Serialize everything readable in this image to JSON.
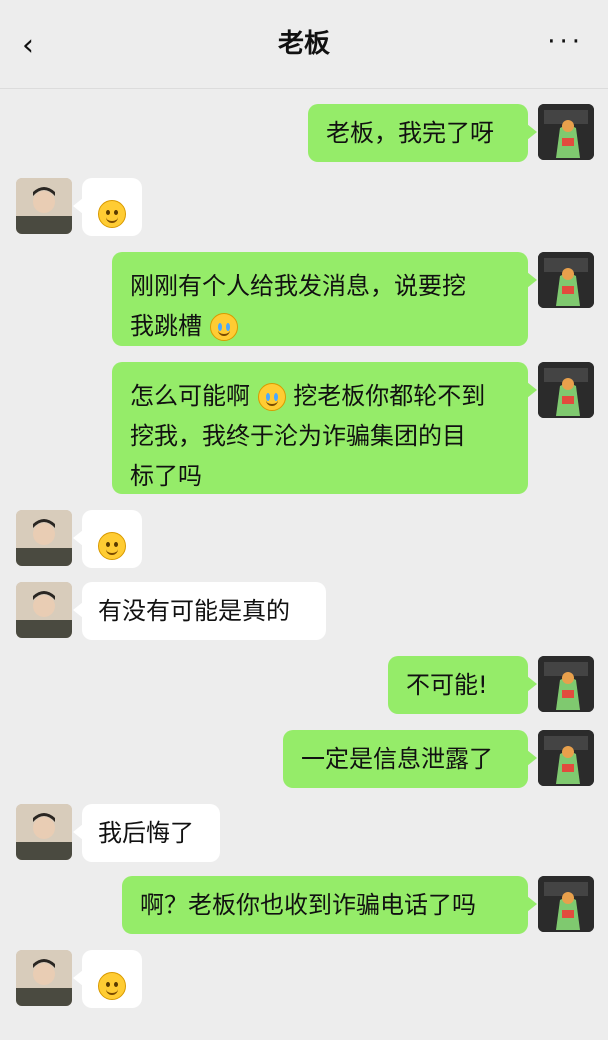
{
  "nav": {
    "back_glyph": "‹",
    "title": "老板",
    "more_glyph": "···"
  },
  "messages": [
    {
      "sender": "me",
      "text": "老板，我完了呀"
    },
    {
      "sender": "other",
      "text": "",
      "emoji": "thinking-face-icon"
    },
    {
      "sender": "me",
      "text_parts": [
        "刚刚有个人给我发消息，说要挖",
        "我跳槽"
      ],
      "emoji": "crying-face-icon"
    },
    {
      "sender": "me",
      "text_parts": [
        "怎么可能啊",
        "挖老板你都轮不到",
        "挖我，我终于沦为诈骗集团的目",
        "标了吗"
      ],
      "emoji": "crying-face-icon"
    },
    {
      "sender": "other",
      "text": "",
      "emoji": "smile-face-icon"
    },
    {
      "sender": "other",
      "text": "有没有可能是真的"
    },
    {
      "sender": "me",
      "text": "不可能!"
    },
    {
      "sender": "me",
      "text": "一定是信息泄露了"
    },
    {
      "sender": "other",
      "text": "我后悔了"
    },
    {
      "sender": "me",
      "text": "啊？老板你也收到诈骗电话了吗"
    },
    {
      "sender": "other",
      "text": "",
      "emoji": "smile-face-icon"
    }
  ],
  "colors": {
    "background": "#ededed",
    "my_bubble": "#95ec69",
    "their_bubble": "#ffffff"
  }
}
